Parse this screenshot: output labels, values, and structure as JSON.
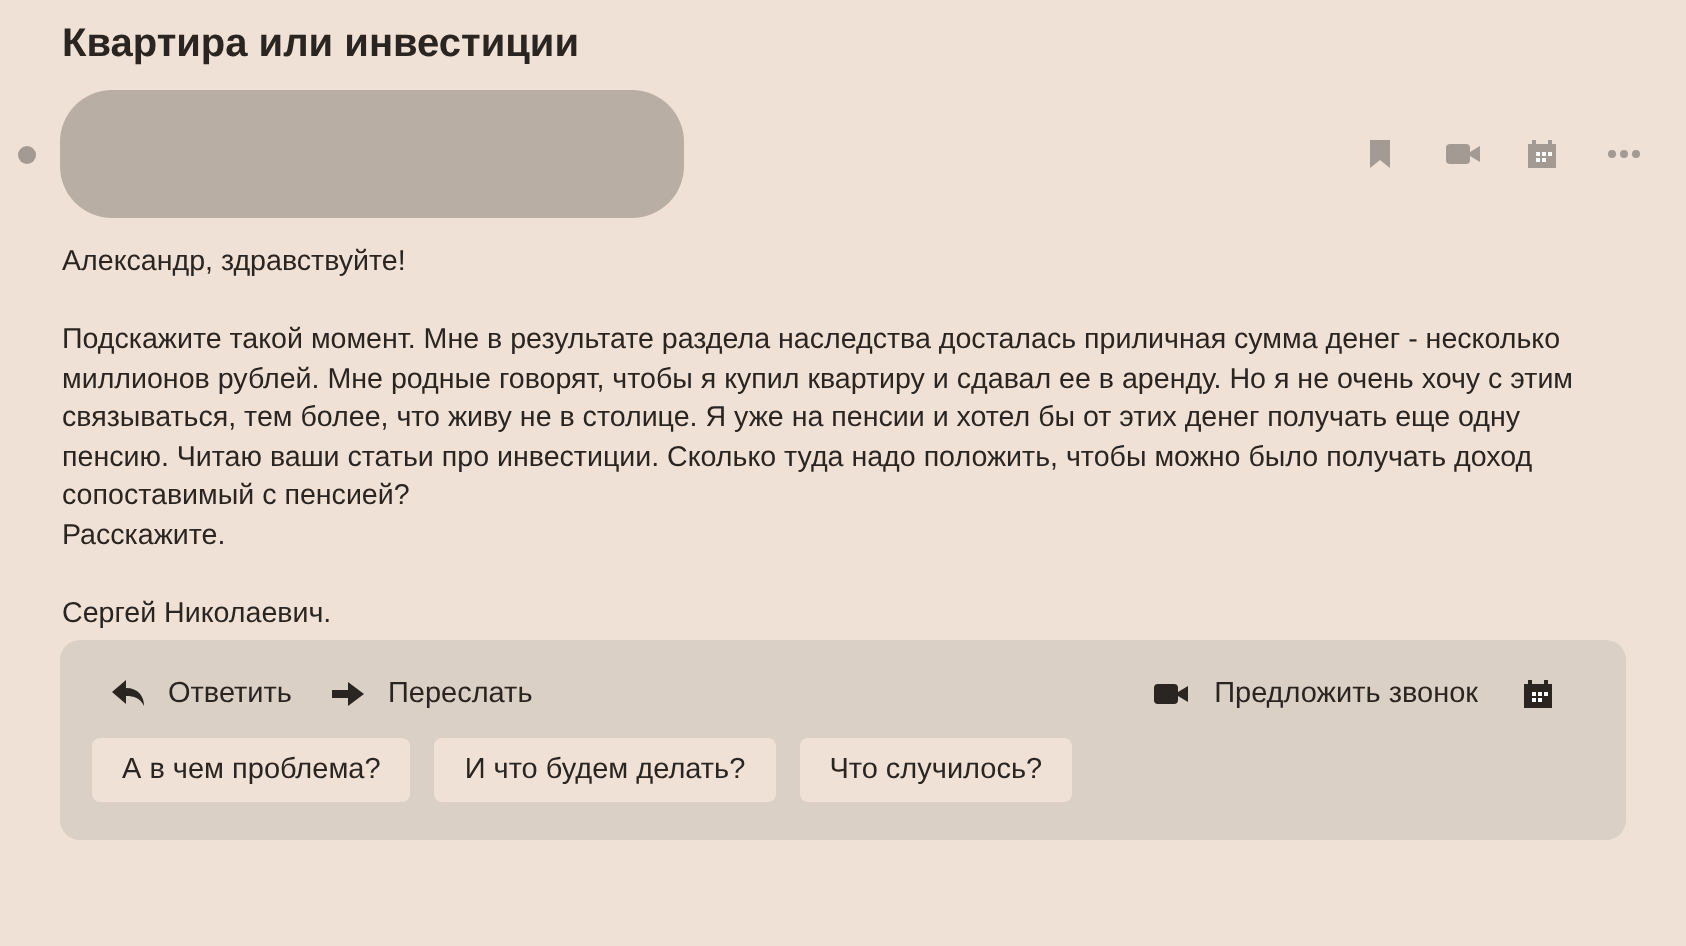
{
  "subject": "Квартира или инвестиции",
  "sender": {
    "unread": true
  },
  "body": [
    "Александр, здравствуйте!",
    "Подскажите такой момент. Мне в результате раздела наследства досталась приличная сумма денег - несколько миллионов рублей. Мне родные говорят, чтобы я купил квартиру и сдавал ее в аренду. Но я не очень хочу с этим связываться, тем более, что живу не в столице. Я уже на пенсии и хотел бы от этих денег получать еще одну пенсию. Читаю ваши статьи про инвестиции. Сколько туда надо положить, чтобы можно было получать доход сопоставимый с пенсией?\nРасскажите.",
    "Сергей Николаевич."
  ],
  "actions": [
    {
      "kind": "reply",
      "label": "Ответить"
    },
    {
      "kind": "forward",
      "label": "Переслать"
    }
  ],
  "call": {
    "label": "Предложить звонок"
  },
  "quick_replies": [
    "А в чем проблема?",
    "И что будем делать?",
    "Что случилось?"
  ]
}
